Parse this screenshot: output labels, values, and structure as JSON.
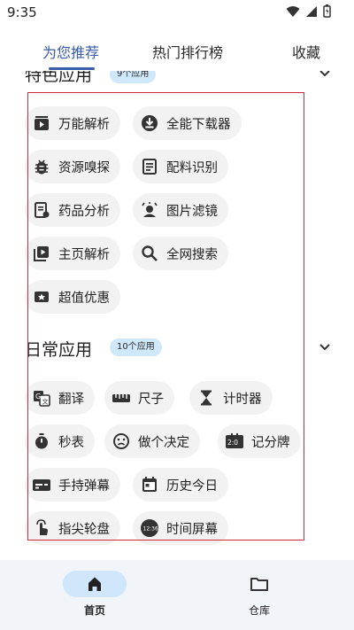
{
  "status_bar": {
    "time": "9:35",
    "icons": [
      "wifi-icon",
      "signal-icon",
      "battery-icon"
    ]
  },
  "top_tabs": [
    {
      "label": "为您推荐",
      "active": true
    },
    {
      "label": "热门排行榜",
      "active": false
    },
    {
      "label": "收藏",
      "active": false
    }
  ],
  "sections": {
    "featured": {
      "title": "特色应用",
      "badge": "9个应用"
    },
    "daily": {
      "title": "日常应用",
      "badge": "10个应用"
    }
  },
  "featured_apps": [
    {
      "label": "万能解析",
      "icon": "video-parse-icon"
    },
    {
      "label": "全能下载器",
      "icon": "download-icon"
    },
    {
      "label": "资源嗅探",
      "icon": "bug-icon"
    },
    {
      "label": "配料识别",
      "icon": "ingredient-list-icon"
    },
    {
      "label": "药品分析",
      "icon": "medicine-icon"
    },
    {
      "label": "图片滤镜",
      "icon": "photo-filter-icon"
    },
    {
      "label": "主页解析",
      "icon": "playlist-play-icon"
    },
    {
      "label": "全网搜索",
      "icon": "search-icon"
    },
    {
      "label": "超值优惠",
      "icon": "coupon-icon"
    }
  ],
  "daily_apps": [
    {
      "label": "翻译",
      "icon": "translate-icon"
    },
    {
      "label": "尺子",
      "icon": "ruler-icon"
    },
    {
      "label": "计时器",
      "icon": "hourglass-icon"
    },
    {
      "label": "秒表",
      "icon": "stopwatch-icon"
    },
    {
      "label": "做个决定",
      "icon": "decision-face-icon"
    },
    {
      "label": "记分牌",
      "icon": "scoreboard-icon"
    },
    {
      "label": "手持弹幕",
      "icon": "subtitles-icon"
    },
    {
      "label": "历史今日",
      "icon": "calendar-icon"
    },
    {
      "label": "指尖轮盘",
      "icon": "touch-icon"
    },
    {
      "label": "时间屏幕",
      "icon": "clock-screen-icon"
    }
  ],
  "bottom_nav": [
    {
      "label": "首页",
      "icon": "home-icon",
      "active": true
    },
    {
      "label": "仓库",
      "icon": "folder-icon",
      "active": false
    }
  ],
  "colors": {
    "accent": "#3a5ba8",
    "chip_bg": "#f2f2f2",
    "badge_bg": "#cfe8fb",
    "highlight": "#cc2a3a",
    "nav_bg": "#f1f4f9"
  }
}
